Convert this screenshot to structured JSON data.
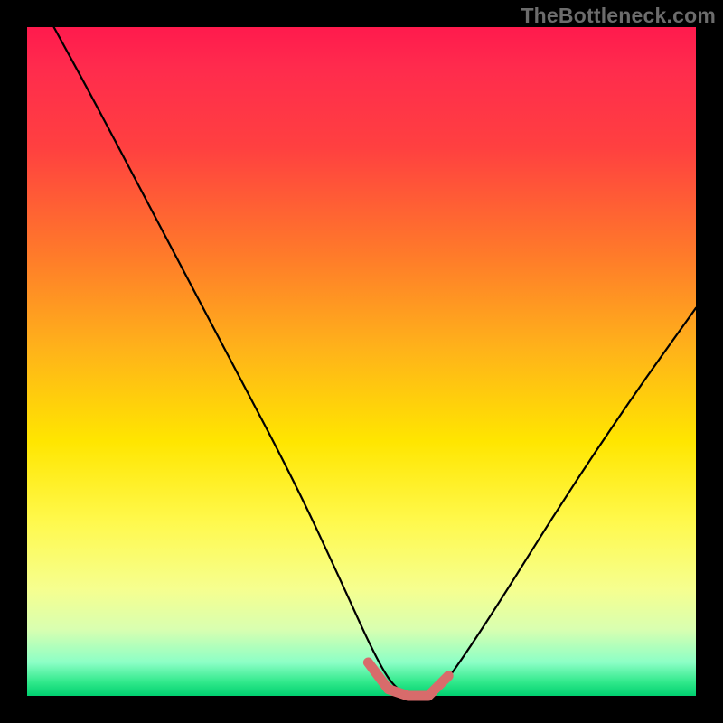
{
  "watermark": "TheBottleneck.com",
  "chart_data": {
    "type": "line",
    "title": "",
    "xlabel": "",
    "ylabel": "",
    "xlim": [
      0,
      100
    ],
    "ylim": [
      0,
      100
    ],
    "series": [
      {
        "name": "bottleneck-curve",
        "x": [
          4,
          10,
          20,
          30,
          40,
          47,
          52,
          55,
          58,
          61,
          64,
          70,
          80,
          90,
          100
        ],
        "values": [
          100,
          89,
          70,
          51,
          32,
          17,
          6,
          1,
          0,
          0,
          4,
          13,
          29,
          44,
          58
        ]
      }
    ],
    "marker": {
      "name": "optimal-range",
      "x": [
        51,
        54,
        57,
        60,
        63
      ],
      "values": [
        5,
        1,
        0,
        0,
        3
      ],
      "color": "#d86b6b"
    }
  }
}
